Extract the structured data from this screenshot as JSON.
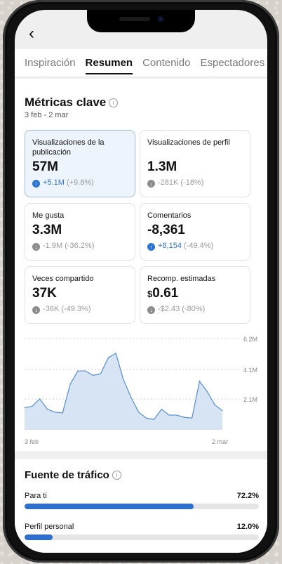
{
  "nav": {
    "back_glyph": "‹"
  },
  "tabs": [
    {
      "label": "Inspiración",
      "active": false
    },
    {
      "label": "Resumen",
      "active": true
    },
    {
      "label": "Contenido",
      "active": false
    },
    {
      "label": "Espectadores",
      "active": false
    }
  ],
  "metrics_section": {
    "title": "Métricas clave",
    "info_glyph": "i",
    "date_range": "3 feb - 2 mar"
  },
  "metrics": [
    {
      "label": "Visualizaciones de la publicación",
      "value": "57M",
      "delta_main": "+5.1M",
      "delta_pct": "(+9.8%)",
      "direction": "up",
      "selected": true
    },
    {
      "label": "Visualizaciones de perfil",
      "value": "1.3M",
      "delta_main": "-281K",
      "delta_pct": "(-18%)",
      "direction": "down",
      "selected": false
    },
    {
      "label": "Me gusta",
      "value": "3.3M",
      "delta_main": "-1.9M",
      "delta_pct": "(-36.2%)",
      "direction": "down",
      "selected": false
    },
    {
      "label": "Comentarios",
      "value": "-8,361",
      "delta_main": "+8,154",
      "delta_pct": "(-49.4%)",
      "direction": "up",
      "selected": false
    },
    {
      "label": "Veces compartido",
      "value": "37K",
      "delta_main": "-36K",
      "delta_pct": "(-49.3%)",
      "direction": "down",
      "selected": false
    },
    {
      "label": "Recomp. estimadas",
      "value_prefix": "$",
      "value": "0.61",
      "delta_main": "-$2.43",
      "delta_pct": "(-80%)",
      "direction": "down",
      "selected": false
    }
  ],
  "chart_data": {
    "type": "area",
    "x_start_label": "3 feb",
    "x_end_label": "2 mar",
    "y_ticks": [
      "2.1M",
      "4.1M",
      "6.2M"
    ],
    "y_tick_values": [
      2.1,
      4.1,
      6.2
    ],
    "ylim": [
      0,
      6.2
    ],
    "values": [
      1.5,
      1.6,
      2.1,
      1.4,
      1.2,
      1.15,
      3.1,
      4.0,
      4.0,
      3.7,
      3.8,
      4.9,
      5.2,
      3.4,
      2.2,
      1.2,
      0.8,
      0.7,
      1.4,
      1.0,
      1.0,
      0.85,
      0.8,
      3.3,
      2.6,
      1.7,
      1.3
    ],
    "color": "#5f93d3",
    "fill_color": "#d7e4f4"
  },
  "traffic": {
    "title": "Fuente de tráfico",
    "info_glyph": "i",
    "rows": [
      {
        "label": "Para ti",
        "pct": "72.2%",
        "fraction": 0.722
      },
      {
        "label": "Perfil personal",
        "pct": "12.0%",
        "fraction": 0.12
      }
    ]
  }
}
